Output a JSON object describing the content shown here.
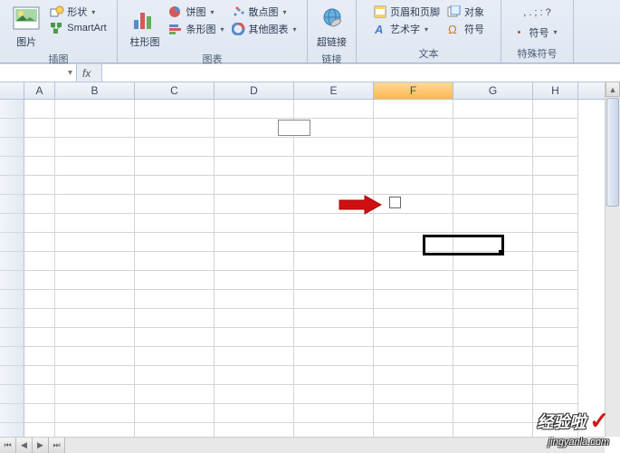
{
  "ribbon": {
    "groups": {
      "illustrations": {
        "label": "插图",
        "picture": "图片",
        "shapes": "形状",
        "smartart": "SmartArt"
      },
      "charts": {
        "label": "图表",
        "column": "柱形图",
        "pie": "饼图",
        "bar": "条形图",
        "scatter": "散点图",
        "other": "其他图表"
      },
      "links": {
        "label": "链接",
        "hyperlink": "超链接"
      },
      "text": {
        "label": "文本",
        "header_footer": "页眉和页脚",
        "wordart": "艺术字",
        "object": "对象",
        "symbol": "符号"
      },
      "special": {
        "label": "特殊符号",
        "symbols": "符号",
        "dots": ", . ; : ?"
      }
    }
  },
  "columns": [
    "A",
    "B",
    "C",
    "D",
    "E",
    "F",
    "G",
    "H"
  ],
  "watermark": {
    "title": "经验啦",
    "url": "jingyanla.com"
  }
}
